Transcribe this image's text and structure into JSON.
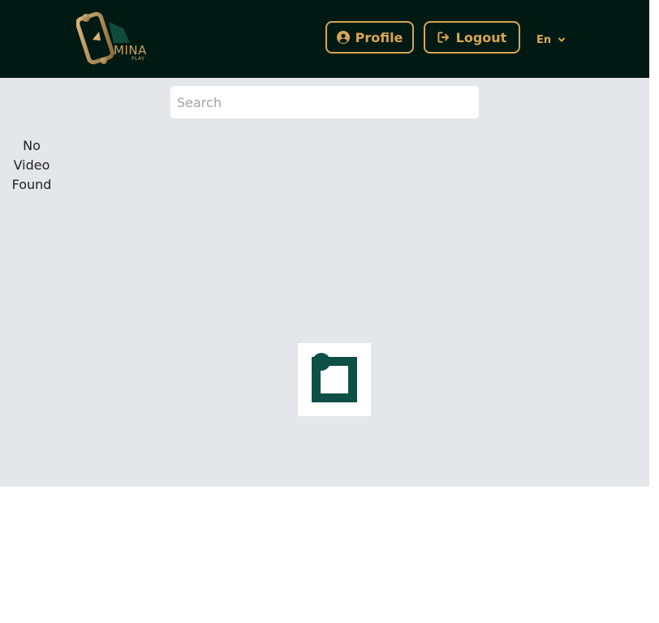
{
  "header": {
    "logo": {
      "name": "MINA",
      "sub": "PLAY",
      "icon": "phone-play-logo"
    },
    "profile_button": {
      "label": "Profile",
      "icon": "user-circle-icon"
    },
    "logout_button": {
      "label": "Logout",
      "icon": "sign-out-icon"
    },
    "language": {
      "selected": "En",
      "icon": "chevron-down-icon"
    }
  },
  "search": {
    "placeholder": "Search",
    "value": ""
  },
  "empty_state": {
    "message": "No Video Found"
  },
  "loader": {
    "icon": "loading-spinner-icon"
  },
  "colors": {
    "header_bg": "#001a13",
    "accent": "#d8a455",
    "content_bg": "#e5e6ea",
    "loader": "#0f5046"
  }
}
